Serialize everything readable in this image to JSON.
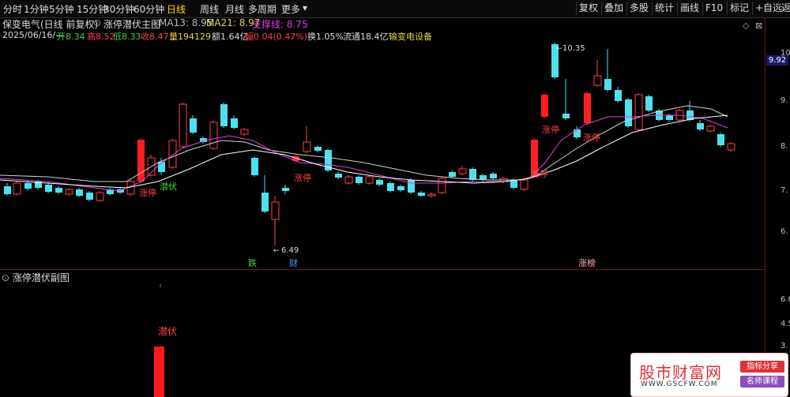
{
  "toolbar": {
    "periods": [
      {
        "label": "分时",
        "active": false
      },
      {
        "label": "1分钟",
        "active": false
      },
      {
        "label": "5分钟",
        "active": false
      },
      {
        "label": "15分钟",
        "active": false
      },
      {
        "label": "30分钟",
        "active": false
      },
      {
        "label": "60分钟",
        "active": false
      },
      {
        "label": "日线",
        "active": true
      },
      {
        "label": "周线",
        "active": false
      },
      {
        "label": "月线",
        "active": false
      },
      {
        "label": "多周期",
        "active": false
      },
      {
        "label": "更多",
        "active": false
      }
    ],
    "more_arrow": "▾",
    "buttons": [
      "复权",
      "叠加",
      "多股",
      "统计",
      "画线",
      "F10",
      "标记",
      "+自选",
      "返"
    ]
  },
  "info": {
    "stock": "保变电气(日线 前复权)",
    "indicator": "涨停潜伏主图",
    "ma13": "MA13: 8.95",
    "ma21": "MA21: 8.97",
    "support": "支撑线: 8.75",
    "date": "2025/06/16/—",
    "open": "开8.34",
    "high": "高8.52",
    "low": "低8.33",
    "close": "收8.47",
    "vol": "量194129",
    "amount": "额1.64亿",
    "change": "幅0.04(0.47%)",
    "turnover": "换1.05%",
    "float": "流通18.4亿",
    "sector": "输变电设备"
  },
  "axis": {
    "main_ticks": [
      "10.",
      "9.",
      "8.",
      "7.",
      "6."
    ],
    "current_price": "9.92",
    "sub_ticks": [
      "6.0",
      "4.5",
      "3."
    ]
  },
  "annotations": {
    "high_price": "10.35",
    "low_price": "6.49",
    "limit_up": "涨停",
    "lurk": "潜伏",
    "event_fall": "跌",
    "event_finance": "财",
    "event_limit": "涨榜"
  },
  "sub_panel": {
    "title": "涨停潜伏副图",
    "signal_label": "潜伏"
  },
  "watermark": {
    "site": "股市财富网",
    "url": "WWW.GSCFW.COM",
    "tag1": "指标分享",
    "tag2": "名师课程"
  },
  "chart_data": {
    "type": "candlestick",
    "series": [
      {
        "name": "MA13",
        "color": "#e040e0"
      },
      {
        "name": "MA21",
        "color": "#e0e0e0"
      }
    ],
    "markers": {
      "limit_up_labels": 6,
      "high": 10.35,
      "low": 6.49
    }
  }
}
